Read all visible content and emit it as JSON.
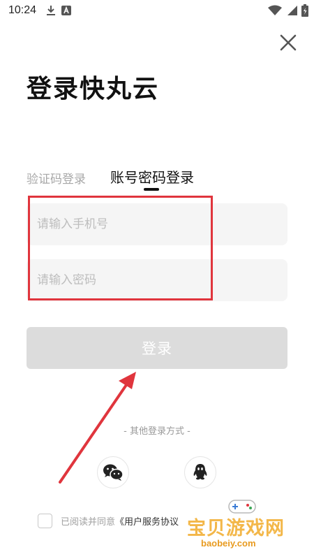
{
  "status_bar": {
    "time": "10:24",
    "icons_left": [
      "download-icon",
      "a-icon"
    ],
    "icons_right": [
      "wifi-icon",
      "signal-icon",
      "battery-icon"
    ]
  },
  "header": {
    "title": "登录快丸云"
  },
  "tabs": [
    {
      "label": "验证码登录",
      "active": false
    },
    {
      "label": "账号密码登录",
      "active": true
    }
  ],
  "form": {
    "phone_placeholder": "请输入手机号",
    "phone_value": "",
    "password_placeholder": "请输入密码",
    "password_value": "",
    "login_label": "登录"
  },
  "other_login": {
    "label": "- 其他登录方式 -",
    "methods": [
      "wechat-icon",
      "qq-icon"
    ]
  },
  "agreement": {
    "prefix": "已阅读并同意",
    "link": "《用户服务协议",
    "checked": false
  },
  "watermark": {
    "text": "宝贝游戏网",
    "sub": "baobeiy.com"
  },
  "colors": {
    "highlight": "#e0353d",
    "button_disabled": "#dcdcdc",
    "input_bg": "#f5f5f5",
    "watermark": "#f2b13a"
  }
}
